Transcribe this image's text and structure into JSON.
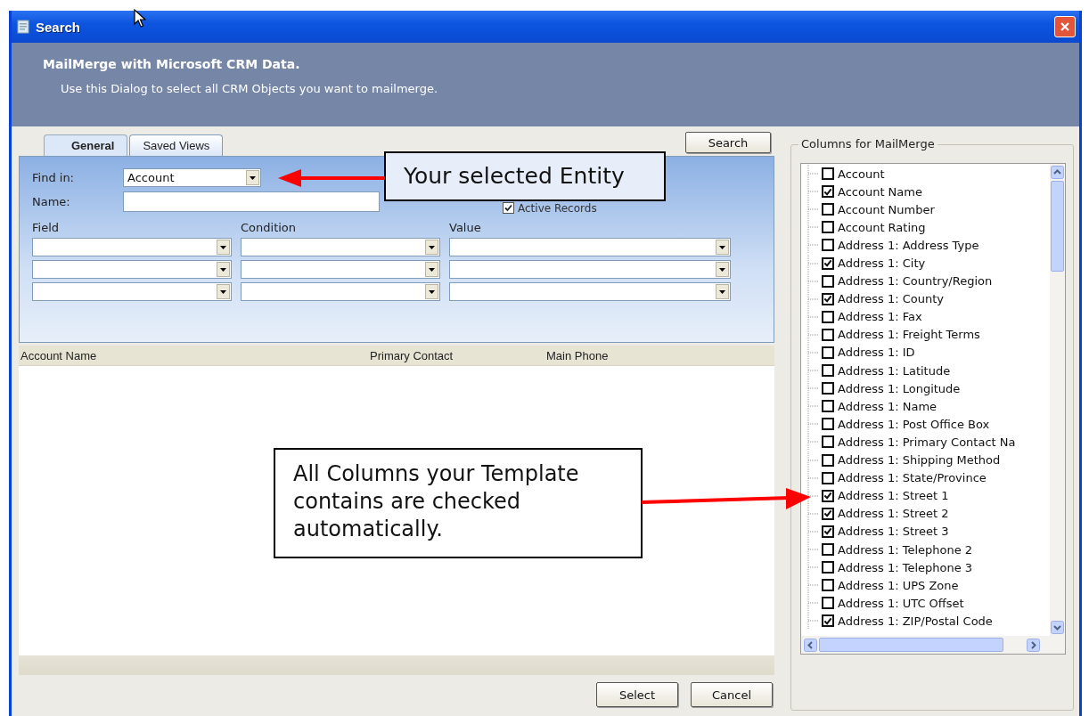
{
  "window": {
    "title": "Search"
  },
  "header": {
    "title": "MailMerge with Microsoft CRM Data.",
    "subtitle": "Use this Dialog to select all CRM Objects you want to mailmerge."
  },
  "tabs": [
    {
      "label": "General",
      "selected": true
    },
    {
      "label": "Saved Views",
      "selected": false
    }
  ],
  "search_button": "Search",
  "filters": {
    "find_in_label": "Find in:",
    "find_in_value": "Account",
    "name_label": "Name:",
    "active_records": {
      "label": "Active Records",
      "checked": true
    }
  },
  "criteria": {
    "columns": [
      "Field",
      "Condition",
      "Value"
    ],
    "rows": [
      {
        "kind": "dropdowns"
      },
      {
        "kind": "dropdowns"
      },
      {
        "kind": "dropdowns"
      }
    ]
  },
  "results": {
    "columns": [
      "Account Name",
      "Primary Contact",
      "Main Phone"
    ]
  },
  "buttons": [
    "Select",
    "Cancel"
  ],
  "columns_panel": {
    "title": "Columns for MailMerge",
    "items": [
      {
        "label": "Account",
        "checked": false
      },
      {
        "label": "Account Name",
        "checked": true
      },
      {
        "label": "Account Number",
        "checked": false
      },
      {
        "label": "Account Rating",
        "checked": false
      },
      {
        "label": "Address 1: Address Type",
        "checked": false
      },
      {
        "label": "Address 1: City",
        "checked": true
      },
      {
        "label": "Address 1: Country/Region",
        "checked": false
      },
      {
        "label": "Address 1: County",
        "checked": true
      },
      {
        "label": "Address 1: Fax",
        "checked": false
      },
      {
        "label": "Address 1: Freight Terms",
        "checked": false
      },
      {
        "label": "Address 1: ID",
        "checked": false
      },
      {
        "label": "Address 1: Latitude",
        "checked": false
      },
      {
        "label": "Address 1: Longitude",
        "checked": false
      },
      {
        "label": "Address 1: Name",
        "checked": false
      },
      {
        "label": "Address 1: Post Office Box",
        "checked": false
      },
      {
        "label": "Address 1: Primary Contact Na",
        "checked": false
      },
      {
        "label": "Address 1: Shipping Method",
        "checked": false
      },
      {
        "label": "Address 1: State/Province",
        "checked": false
      },
      {
        "label": "Address 1: Street 1",
        "checked": true
      },
      {
        "label": "Address 1: Street 2",
        "checked": true
      },
      {
        "label": "Address 1: Street 3",
        "checked": true
      },
      {
        "label": "Address 1: Telephone 2",
        "checked": false
      },
      {
        "label": "Address 1: Telephone 3",
        "checked": false
      },
      {
        "label": "Address 1: UPS Zone",
        "checked": false
      },
      {
        "label": "Address 1: UTC Offset",
        "checked": false
      },
      {
        "label": "Address 1: ZIP/Postal Code",
        "checked": true
      }
    ]
  },
  "callouts": [
    {
      "text": "Your selected Entity"
    },
    {
      "text": "All Columns your Template contains are checked automatically."
    }
  ]
}
